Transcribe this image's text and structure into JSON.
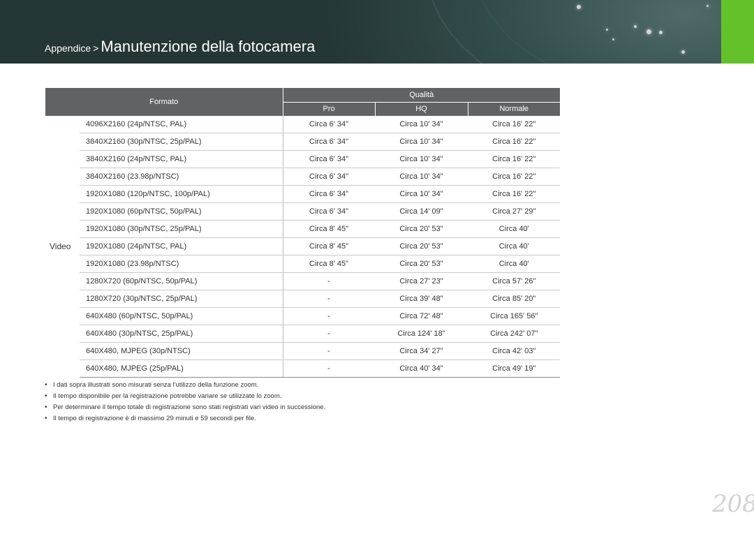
{
  "header": {
    "breadcrumb_parent": "Appendice",
    "breadcrumb_separator": ">",
    "title": "Manutenzione della fotocamera",
    "accent_color": "#63c22a"
  },
  "table": {
    "col_formato": "Formato",
    "col_qualita": "Qualità",
    "col_pro": "Pro",
    "col_hq": "HQ",
    "col_normale": "Normale",
    "category": "Video",
    "rows": [
      {
        "format": "4096X2160 (24p/NTSC, PAL)",
        "pro": "Circa 6' 34\"",
        "hq": "Circa 10' 34\"",
        "normale": "Circa 16' 22\""
      },
      {
        "format": "3840X2160 (30p/NTSC, 25p/PAL)",
        "pro": "Circa 6' 34\"",
        "hq": "Circa 10' 34\"",
        "normale": "Circa 16' 22\""
      },
      {
        "format": "3840X2160 (24p/NTSC, PAL)",
        "pro": "Circa 6' 34\"",
        "hq": "Circa 10' 34\"",
        "normale": "Circa 16' 22\""
      },
      {
        "format": "3840X2160 (23.98p/NTSC)",
        "pro": "Circa 6' 34\"",
        "hq": "Circa 10' 34\"",
        "normale": "Circa 16' 22\""
      },
      {
        "format": "1920X1080 (120p/NTSC, 100p/PAL)",
        "pro": "Circa 6' 34\"",
        "hq": "Circa 10' 34\"",
        "normale": "Circa 16' 22\""
      },
      {
        "format": "1920X1080 (60p/NTSC, 50p/PAL)",
        "pro": "Circa 6' 34\"",
        "hq": "Circa 14' 09\"",
        "normale": "Circa 27' 29\""
      },
      {
        "format": "1920X1080 (30p/NTSC, 25p/PAL)",
        "pro": "Circa 8' 45\"",
        "hq": "Circa 20' 53\"",
        "normale": "Circa 40'"
      },
      {
        "format": "1920X1080 (24p/NTSC, PAL)",
        "pro": "Circa 8' 45\"",
        "hq": "Circa 20' 53\"",
        "normale": "Circa 40'"
      },
      {
        "format": "1920X1080 (23.98p/NTSC)",
        "pro": "Circa 8' 45\"",
        "hq": "Circa 20' 53\"",
        "normale": "Circa 40'"
      },
      {
        "format": "1280X720 (60p/NTSC, 50p/PAL)",
        "pro": "-",
        "hq": "Circa 27' 23\"",
        "normale": "Circa 57' 26\""
      },
      {
        "format": "1280X720 (30p/NTSC, 25p/PAL)",
        "pro": "-",
        "hq": "Circa 39' 48\"",
        "normale": "Circa 85' 20\""
      },
      {
        "format": "640X480 (60p/NTSC, 50p/PAL)",
        "pro": "-",
        "hq": "Circa 72' 48\"",
        "normale": "Circa 165' 56\""
      },
      {
        "format": "640X480 (30p/NTSC, 25p/PAL)",
        "pro": "-",
        "hq": "Circa 124' 18\"",
        "normale": "Circa 242' 07\""
      },
      {
        "format": "640X480, MJPEG (30p/NTSC)",
        "pro": "-",
        "hq": "Circa 34' 27\"",
        "normale": "Circa 42' 03\""
      },
      {
        "format": "640X480, MJPEG (25p/PAL)",
        "pro": "-",
        "hq": "Circa 40' 34\"",
        "normale": "Circa 49' 19\""
      }
    ]
  },
  "notes": {
    "bullet": "•",
    "items": [
      "I dati sopra illustrati sono misurati senza l'utilizzo della funzione zoom.",
      "Il tempo disponibile per la registrazione potrebbe variare se utilizzate lo zoom.",
      "Per determinare il tempo totale di registrazione sono stati registrati vari video in successione.",
      "Il tempo di registrazione è di massimo 29 minuti e 59 secondi per file."
    ]
  },
  "page_number": "208"
}
